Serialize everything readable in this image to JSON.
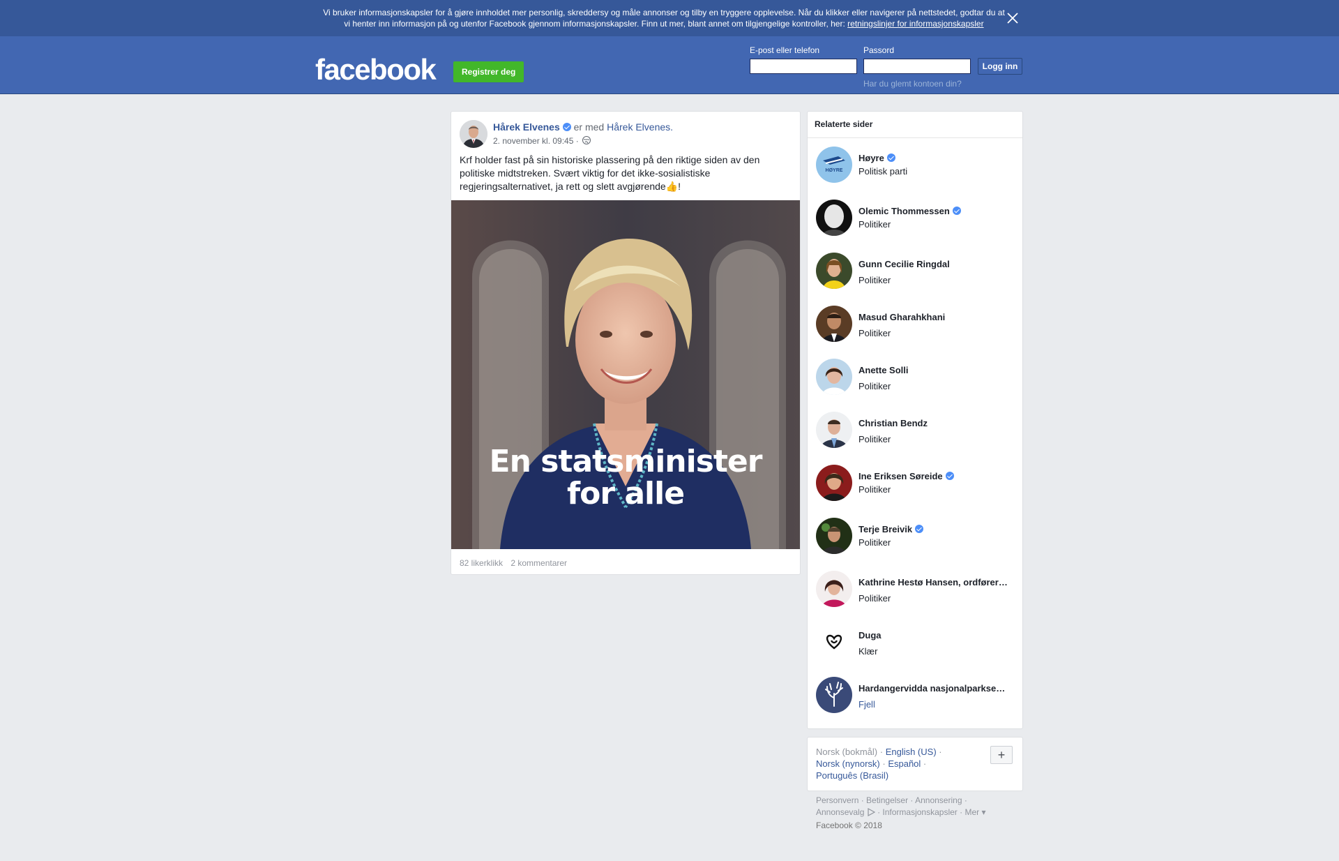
{
  "cookie_banner": {
    "text_line1": "Vi bruker informasjonskapsler for å gjøre innholdet mer personlig, skreddersy og måle annonser og tilby en tryggere opplevelse. Når du klikker eller navigerer på nettstedet, godtar du at",
    "text_line2": "vi henter inn informasjon på og utenfor Facebook gjennom informasjonskapsler. Finn ut mer, blant annet om tilgjengelige kontroller, her:",
    "link": "retningslinjer for informasjonskapsler",
    "close_icon": "close-icon"
  },
  "header": {
    "logo": "facebook",
    "register_label": "Registrer deg",
    "email_label": "E-post eller telefon",
    "email_value": "",
    "password_label": "Passord",
    "password_value": "",
    "login_label": "Logg inn",
    "forgot_label": "Har du glemt kontoen din?"
  },
  "post": {
    "author": "Hårek Elvenes",
    "with_text": "er med",
    "with_name": "Hårek Elvenes.",
    "time": "2. november kl. 09:45 ·",
    "text": "Krf holder fast på sin historiske plassering på den riktige siden av den politiske midtstreken. Svært viktig for det ikke-sosialistiske regjeringsalternativet, ja rett og slett avgjørende👍!",
    "image_caption_line1": "En statsminister",
    "image_caption_line2": "for alle",
    "likes": "82 likerklikk",
    "comments": "2 kommentarer"
  },
  "related": {
    "title": "Relaterte sider",
    "items": [
      {
        "name": "Høyre",
        "category": "Politisk parti",
        "verified": true
      },
      {
        "name": "Olemic Thommessen",
        "category": "Politiker",
        "verified": true
      },
      {
        "name": "Gunn Cecilie Ringdal",
        "category": "Politiker",
        "verified": false
      },
      {
        "name": "Masud Gharahkhani",
        "category": "Politiker",
        "verified": false
      },
      {
        "name": "Anette Solli",
        "category": "Politiker",
        "verified": false
      },
      {
        "name": "Christian Bendz",
        "category": "Politiker",
        "verified": false
      },
      {
        "name": "Ine Eriksen Søreide",
        "category": "Politiker",
        "verified": true
      },
      {
        "name": "Terje Breivik",
        "category": "Politiker",
        "verified": true
      },
      {
        "name": "Kathrine Hestø Hansen, ordfører…",
        "category": "Politiker",
        "verified": false
      },
      {
        "name": "Duga",
        "category": "Klær",
        "verified": false
      },
      {
        "name": "Hardangervidda nasjonalparkse…",
        "category": "Fjell",
        "verified": false
      }
    ],
    "avatar_logo_text": "HØYRE"
  },
  "languages": {
    "current": "Norsk (bokmål)",
    "options": [
      "English (US)",
      "Norsk (nynorsk)",
      "Español",
      "Português (Brasil)"
    ],
    "add_label": "+"
  },
  "footer": {
    "links": [
      "Personvern",
      "Betingelser",
      "Annonsering",
      "Annonsevalg",
      "Informasjonskapsler",
      "Mer"
    ],
    "copyright": "Facebook © 2018"
  },
  "colors": {
    "header_blue": "#4267b2",
    "cookie_blue": "#365899",
    "register_green": "#42b72a",
    "link_blue": "#365899",
    "background": "#e9ebee"
  }
}
